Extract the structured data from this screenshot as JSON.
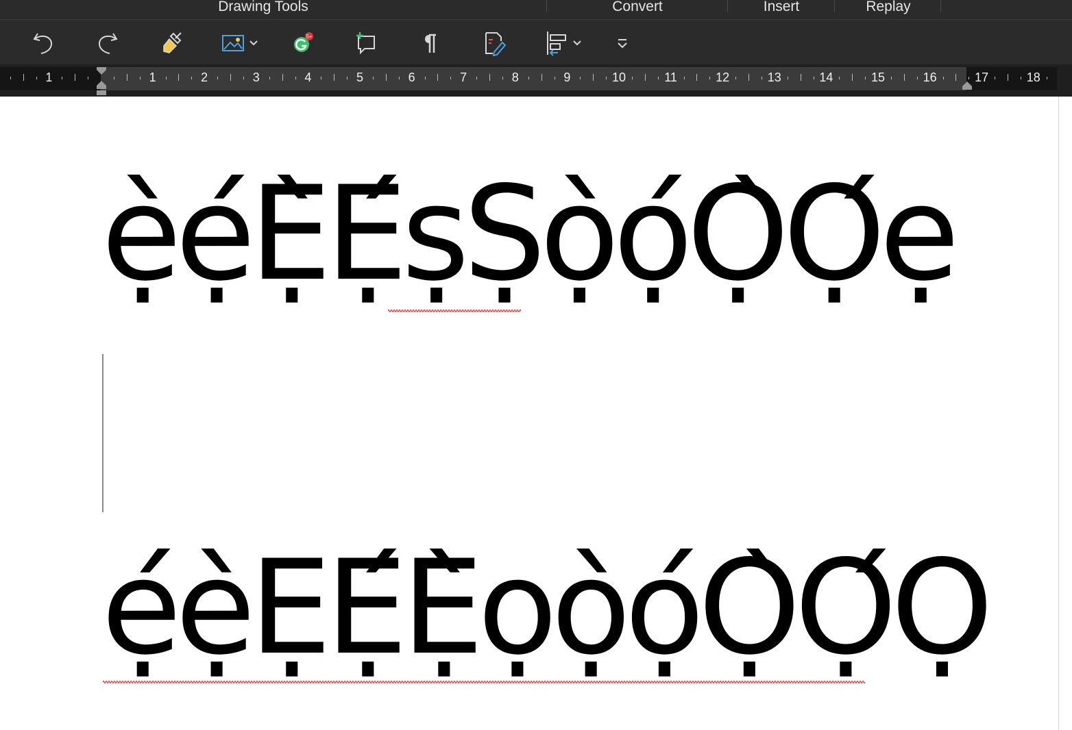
{
  "ribbon": {
    "tabs": [
      "Drawing Tools",
      "Convert",
      "Insert",
      "Replay"
    ]
  },
  "toolbar": {
    "tools": [
      "undo-icon",
      "redo-icon",
      "format-painter-icon",
      "picture-icon",
      "grammarly-icon",
      "new-comment-icon",
      "paragraph-mark-icon",
      "editor-icon",
      "align-left-icon",
      "more-icon"
    ],
    "grammarly_badge": "5+",
    "accent_yellow": "#f2c94c",
    "accent_blue": "#4aa3df",
    "accent_green": "#39c26a"
  },
  "ruler": {
    "numbers_left": [
      "1"
    ],
    "numbers": [
      "1",
      "2",
      "3",
      "4",
      "5",
      "6",
      "7",
      "8",
      "9",
      "10",
      "11",
      "12",
      "13",
      "14",
      "15",
      "16",
      "17",
      "18"
    ]
  },
  "document": {
    "line1": "ẹ̀ẹ́Ẹ̀Ẹ́ṣṢọ̀ọ́Ọ̀Ọ́ẹ",
    "line2": "ẹ́ẹ̀ẸẸ́Ẹ̀ọọ̀ọ́Ọ̀Ọ́Ọ",
    "spell_error_color": "#e03a3a"
  }
}
